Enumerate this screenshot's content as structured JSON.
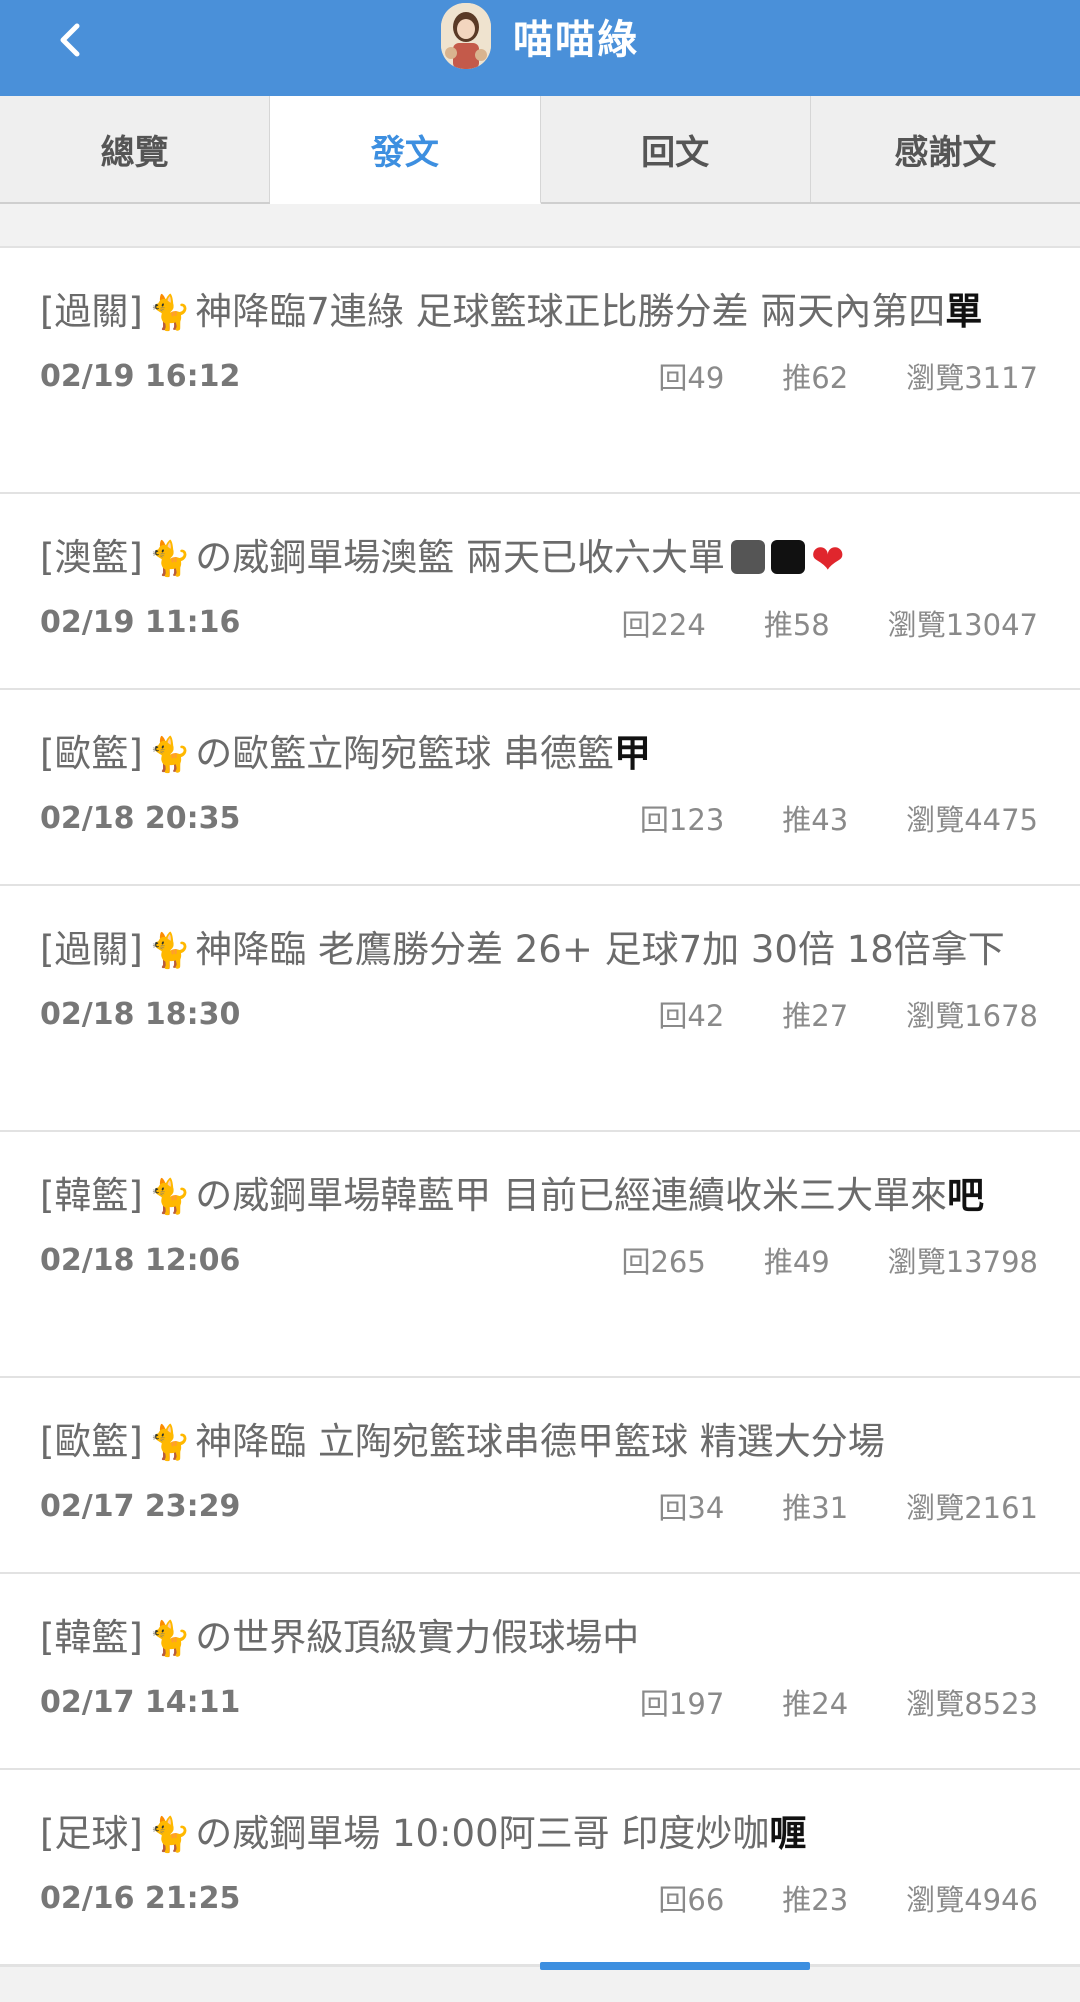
{
  "header": {
    "title": "喵喵綠",
    "back_icon": "chevron-left-icon",
    "avatar_icon": "user-avatar-icon"
  },
  "tabs": [
    {
      "label": "總覽",
      "active": false
    },
    {
      "label": "發文",
      "active": true
    },
    {
      "label": "回文",
      "active": false
    },
    {
      "label": "感謝文",
      "active": false
    }
  ],
  "posts": [
    {
      "prefix": "[過關]",
      "cat": "🐈",
      "title_main": "神降臨7連綠 足球籃球正比勝分差 兩天內第四",
      "title_hl": "單",
      "date": "02/19 16:12",
      "replies": "回49",
      "pushes": "推62",
      "views": "瀏覽3117"
    },
    {
      "prefix": "[澳籃]",
      "cat": "🐈",
      "title_main": "の威鋼單場澳籃 兩天已收六大單",
      "title_hl": "",
      "date": "02/19 11:16",
      "replies": "回224",
      "pushes": "推58",
      "views": "瀏覽13047"
    },
    {
      "prefix": "[歐籃]",
      "cat": "🐈",
      "title_main": "の歐籃立陶宛籃球 串德籃",
      "title_hl": "甲",
      "date": "02/18 20:35",
      "replies": "回123",
      "pushes": "推43",
      "views": "瀏覽4475"
    },
    {
      "prefix": "[過關]",
      "cat": "🐈",
      "title_main": "神降臨 老鷹勝分差 26+ 足球7加 30倍 18倍拿下",
      "title_hl": "",
      "date": "02/18 18:30",
      "replies": "回42",
      "pushes": "推27",
      "views": "瀏覽1678"
    },
    {
      "prefix": "[韓籃]",
      "cat": "🐈",
      "title_main": "の威鋼單場韓藍甲 目前已經連續收米三大單來",
      "title_hl": "吧",
      "date": "02/18 12:06",
      "replies": "回265",
      "pushes": "推49",
      "views": "瀏覽13798"
    },
    {
      "prefix": "[歐籃]",
      "cat": "🐈",
      "title_main": "神降臨 立陶宛籃球串德甲籃球 精選大分場",
      "title_hl": "",
      "date": "02/17 23:29",
      "replies": "回34",
      "pushes": "推31",
      "views": "瀏覽2161"
    },
    {
      "prefix": "[韓籃]",
      "cat": "🐈",
      "title_main": "の世界級頂級實力假球場中",
      "title_hl": "",
      "date": "02/17 14:11",
      "replies": "回197",
      "pushes": "推24",
      "views": "瀏覽8523"
    },
    {
      "prefix": "[足球]",
      "cat": "🐈",
      "title_main": "の威鋼單場 10:00阿三哥 印度炒咖",
      "title_hl": "喱",
      "date": "02/16 21:25",
      "replies": "回66",
      "pushes": "推23",
      "views": "瀏覽4946"
    }
  ]
}
